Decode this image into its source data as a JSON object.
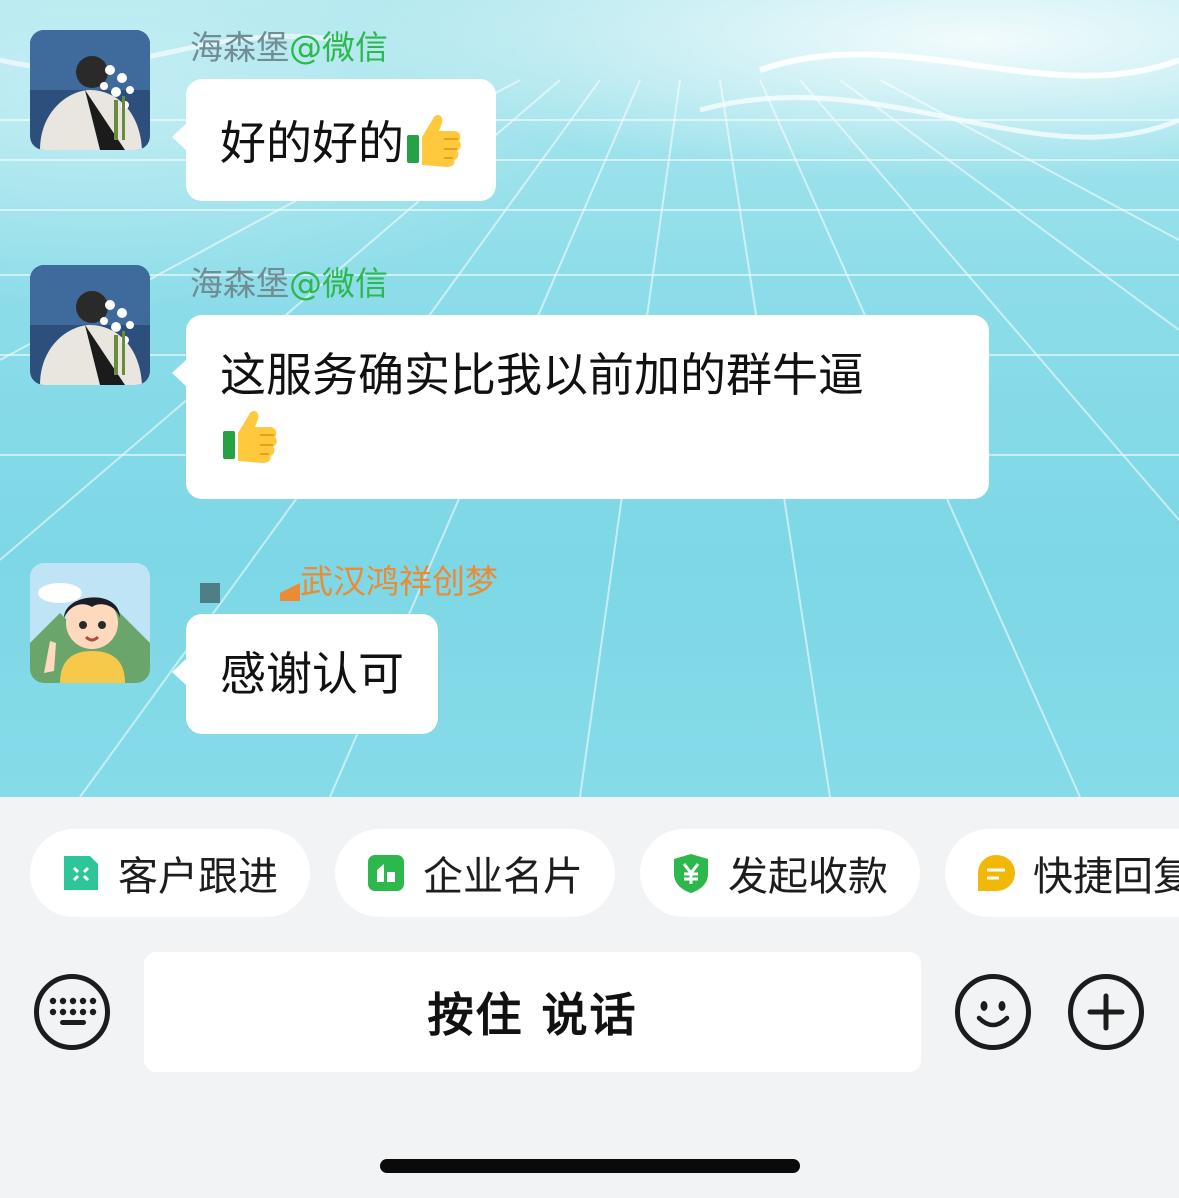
{
  "messages": [
    {
      "sender_name": "海森堡",
      "sender_suffix": "@微信",
      "text": "好的好的",
      "emoji": "thumbs-up"
    },
    {
      "sender_name": "海森堡",
      "sender_suffix": "@微信",
      "text": "这服务确实比我以前加的群牛逼",
      "emoji": "thumbs-up"
    },
    {
      "sender_name": "武汉鸿祥创梦",
      "text": "感谢认可"
    }
  ],
  "quick_actions": [
    {
      "label": "客户跟进",
      "icon": "customer-followup-icon",
      "color": "#2fc59a"
    },
    {
      "label": "企业名片",
      "icon": "business-card-icon",
      "color": "#2db84d"
    },
    {
      "label": "发起收款",
      "icon": "payment-shield-icon",
      "color": "#2db84d"
    },
    {
      "label": "快捷回复",
      "icon": "quick-reply-icon",
      "color": "#f2b807"
    }
  ],
  "input_bar": {
    "hold_to_talk": "按住 说话",
    "keyboard_icon": "keyboard-icon",
    "emoji_icon": "smiley-icon",
    "more_icon": "plus-icon"
  },
  "colors": {
    "accent_green": "#2db84d",
    "sender_orange": "#ec8a36",
    "sender_gray": "#6f8d92"
  }
}
